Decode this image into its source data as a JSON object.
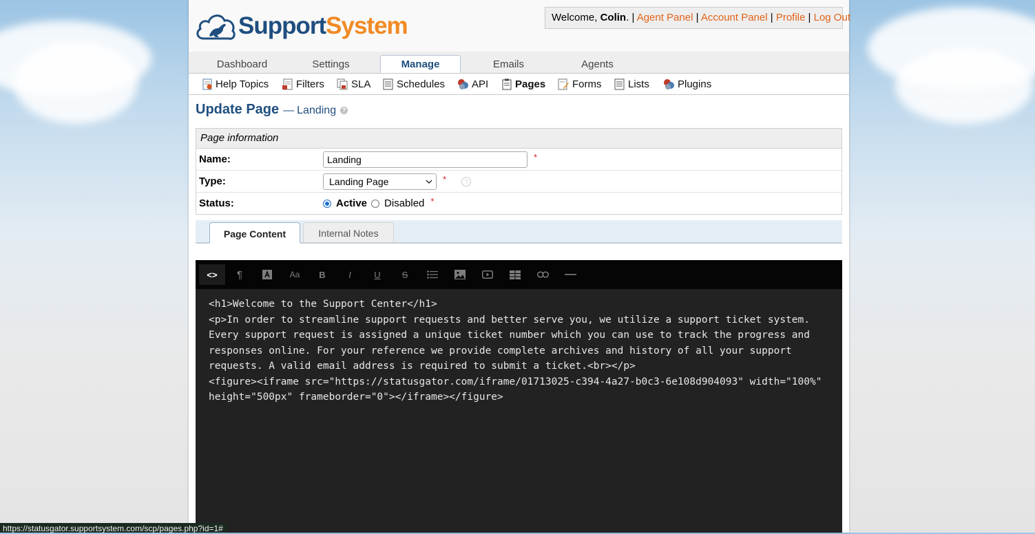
{
  "app": {
    "logo": {
      "word1": "Support",
      "word2": "System"
    }
  },
  "user": {
    "welcome_prefix": "Welcome,",
    "name": "Colin",
    "name_suffix": ".",
    "separator": "|",
    "links": [
      "Agent Panel",
      "Account Panel",
      "Profile",
      "Log Out"
    ]
  },
  "nav": {
    "tabs": [
      "Dashboard",
      "Settings",
      "Manage",
      "Emails",
      "Agents"
    ],
    "active_tab": "Manage"
  },
  "subnav": {
    "items": [
      {
        "label": "Help Topics",
        "icon": "help-topics-icon"
      },
      {
        "label": "Filters",
        "icon": "filters-icon"
      },
      {
        "label": "SLA",
        "icon": "sla-icon"
      },
      {
        "label": "Schedules",
        "icon": "schedules-icon"
      },
      {
        "label": "API",
        "icon": "api-icon"
      },
      {
        "label": "Pages",
        "icon": "pages-icon"
      },
      {
        "label": "Forms",
        "icon": "forms-icon"
      },
      {
        "label": "Lists",
        "icon": "lists-icon"
      },
      {
        "label": "Plugins",
        "icon": "plugins-icon"
      }
    ],
    "active_item": "Pages"
  },
  "page": {
    "title": "Update Page",
    "dash": "—",
    "subtitle": "Landing",
    "help_glyph": "?"
  },
  "form": {
    "section_title": "Page information",
    "required_marker": "*",
    "name": {
      "label": "Name:",
      "value": "Landing"
    },
    "type": {
      "label": "Type:",
      "selected": "Landing Page"
    },
    "status": {
      "label": "Status:",
      "options": [
        "Active",
        "Disabled"
      ],
      "selected": "Active"
    }
  },
  "content_tabs": {
    "items": [
      "Page Content",
      "Internal Notes"
    ],
    "active": "Page Content"
  },
  "editor": {
    "toolbar": [
      "code-view",
      "paragraph",
      "text-color",
      "font-size",
      "bold",
      "italic",
      "underline",
      "strikethrough",
      "bulleted-list",
      "image",
      "video",
      "table",
      "link",
      "horizontal-rule"
    ],
    "active_tool": "code-view",
    "toolbar_glyphs": {
      "code_view": "<>",
      "font_size": "Aa",
      "bold": "B",
      "italic": "I",
      "underline": "U",
      "strikethrough": "S"
    },
    "content": "<h1>Welcome to the Support Center</h1>\n<p>In order to streamline support requests and better serve you, we utilize a support ticket system. Every support request is assigned a unique ticket number which you can use to track the progress and responses online. For your reference we provide complete archives and history of all your support requests. A valid email address is required to submit a ticket.<br></p>\n<figure><iframe src=\"https://statusgator.com/iframe/01713025-c394-4a27-b0c3-6e108d904093\" width=\"100%\" height=\"500px\" frameborder=\"0\"></iframe></figure>"
  },
  "status_bar": {
    "url": "https://statusgator.supportsystem.com/scp/pages.php?id=1#"
  },
  "colors": {
    "brand_blue": "#1f4e7f",
    "brand_orange": "#f08a24",
    "link_orange": "#e2641a",
    "editor_bg": "#222222",
    "toolbar_bg": "#050505"
  }
}
